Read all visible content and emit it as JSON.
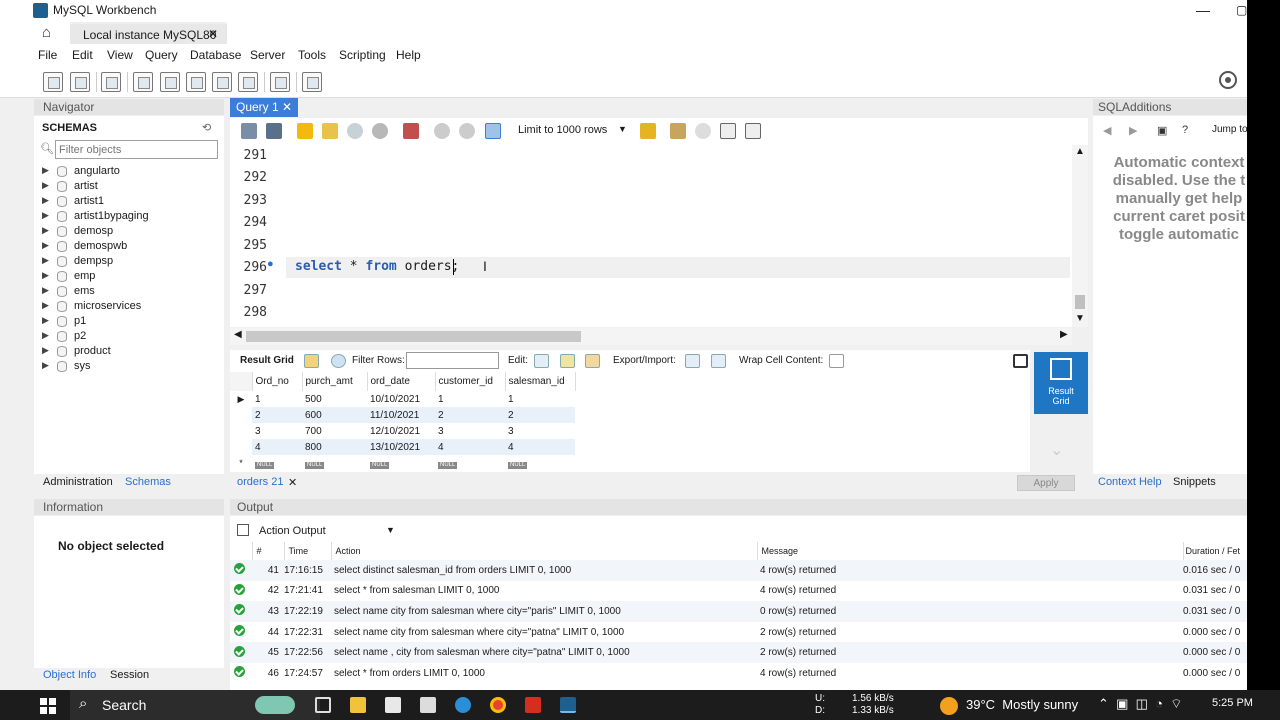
{
  "app": {
    "title": "MySQL Workbench",
    "connection_tab": "Local instance MySQL80"
  },
  "menu": [
    "File",
    "Edit",
    "View",
    "Query",
    "Database",
    "Server",
    "Tools",
    "Scripting",
    "Help"
  ],
  "navigator": {
    "title": "Navigator",
    "schemas_label": "SCHEMAS",
    "filter_placeholder": "Filter objects",
    "schemas": [
      "angularto",
      "artist",
      "artist1",
      "artist1bypaging",
      "demosp",
      "demospwb",
      "dempsp",
      "emp",
      "ems",
      "microservices",
      "p1",
      "p2",
      "product",
      "sys"
    ],
    "tabs": [
      "Administration",
      "Schemas"
    ]
  },
  "information": {
    "title": "Information",
    "message": "No object selected",
    "tabs": [
      "Object Info",
      "Session"
    ]
  },
  "query_tab": {
    "label": "Query 1",
    "limit_label": "Limit to 1000 rows"
  },
  "editor": {
    "lines": [
      "291",
      "292",
      "293",
      "294",
      "295",
      "296",
      "297",
      "298"
    ],
    "code_kw1": "select",
    "code_mid": " * ",
    "code_kw2": "from",
    "code_tail": " orders;"
  },
  "result_bar": {
    "result_grid": "Result Grid",
    "filter_rows": "Filter Rows:",
    "edit": "Edit:",
    "export": "Export/Import:",
    "wrap": "Wrap Cell Content:"
  },
  "result_grid": {
    "columns": [
      "Ord_no",
      "purch_amt",
      "ord_date",
      "customer_id",
      "salesman_id"
    ],
    "rows": [
      [
        "1",
        "500",
        "10/10/2021",
        "1",
        "1"
      ],
      [
        "2",
        "600",
        "11/10/2021",
        "2",
        "2"
      ],
      [
        "3",
        "700",
        "12/10/2021",
        "3",
        "3"
      ],
      [
        "4",
        "800",
        "13/10/2021",
        "4",
        "4"
      ]
    ],
    "null_label": "NULL",
    "side_button": "Result Grid"
  },
  "result_tab": {
    "label": "orders 21",
    "apply": "Apply"
  },
  "sql_additions": {
    "title": "SQLAdditions",
    "jump_to": "Jump to",
    "message": "Automatic context\ndisabled. Use the t\nmanually get help\ncurrent caret posit\ntoggle automatic",
    "tabs": [
      "Context Help",
      "Snippets"
    ]
  },
  "output": {
    "title": "Output",
    "selector": "Action Output",
    "columns": [
      "#",
      "Time",
      "Action",
      "Message",
      "Duration / Fet"
    ],
    "rows": [
      [
        "41",
        "17:16:15",
        "select distinct salesman_id from orders LIMIT 0, 1000",
        "4 row(s) returned",
        "0.016 sec / 0"
      ],
      [
        "42",
        "17:21:41",
        "select * from salesman LIMIT 0, 1000",
        "4 row(s) returned",
        "0.031 sec / 0"
      ],
      [
        "43",
        "17:22:19",
        "select name city from salesman where city=\"paris\" LIMIT 0, 1000",
        "0 row(s) returned",
        "0.031 sec / 0"
      ],
      [
        "44",
        "17:22:31",
        "select name city from salesman where city=\"patna\" LIMIT 0, 1000",
        "2 row(s) returned",
        "0.000 sec / 0"
      ],
      [
        "45",
        "17:22:56",
        "select name , city from salesman where city=\"patna\" LIMIT 0, 1000",
        "2 row(s) returned",
        "0.000 sec / 0"
      ],
      [
        "46",
        "17:24:57",
        "select * from orders LIMIT 0, 1000",
        "4 row(s) returned",
        "0.000 sec / 0"
      ]
    ]
  },
  "taskbar": {
    "search": "Search",
    "net_up_label": "U:",
    "net_up": "1.56 kB/s",
    "net_down_label": "D:",
    "net_down": "1.33 kB/s",
    "weather": "39°C",
    "weather_desc": "Mostly sunny",
    "time": "5:25 PM"
  }
}
